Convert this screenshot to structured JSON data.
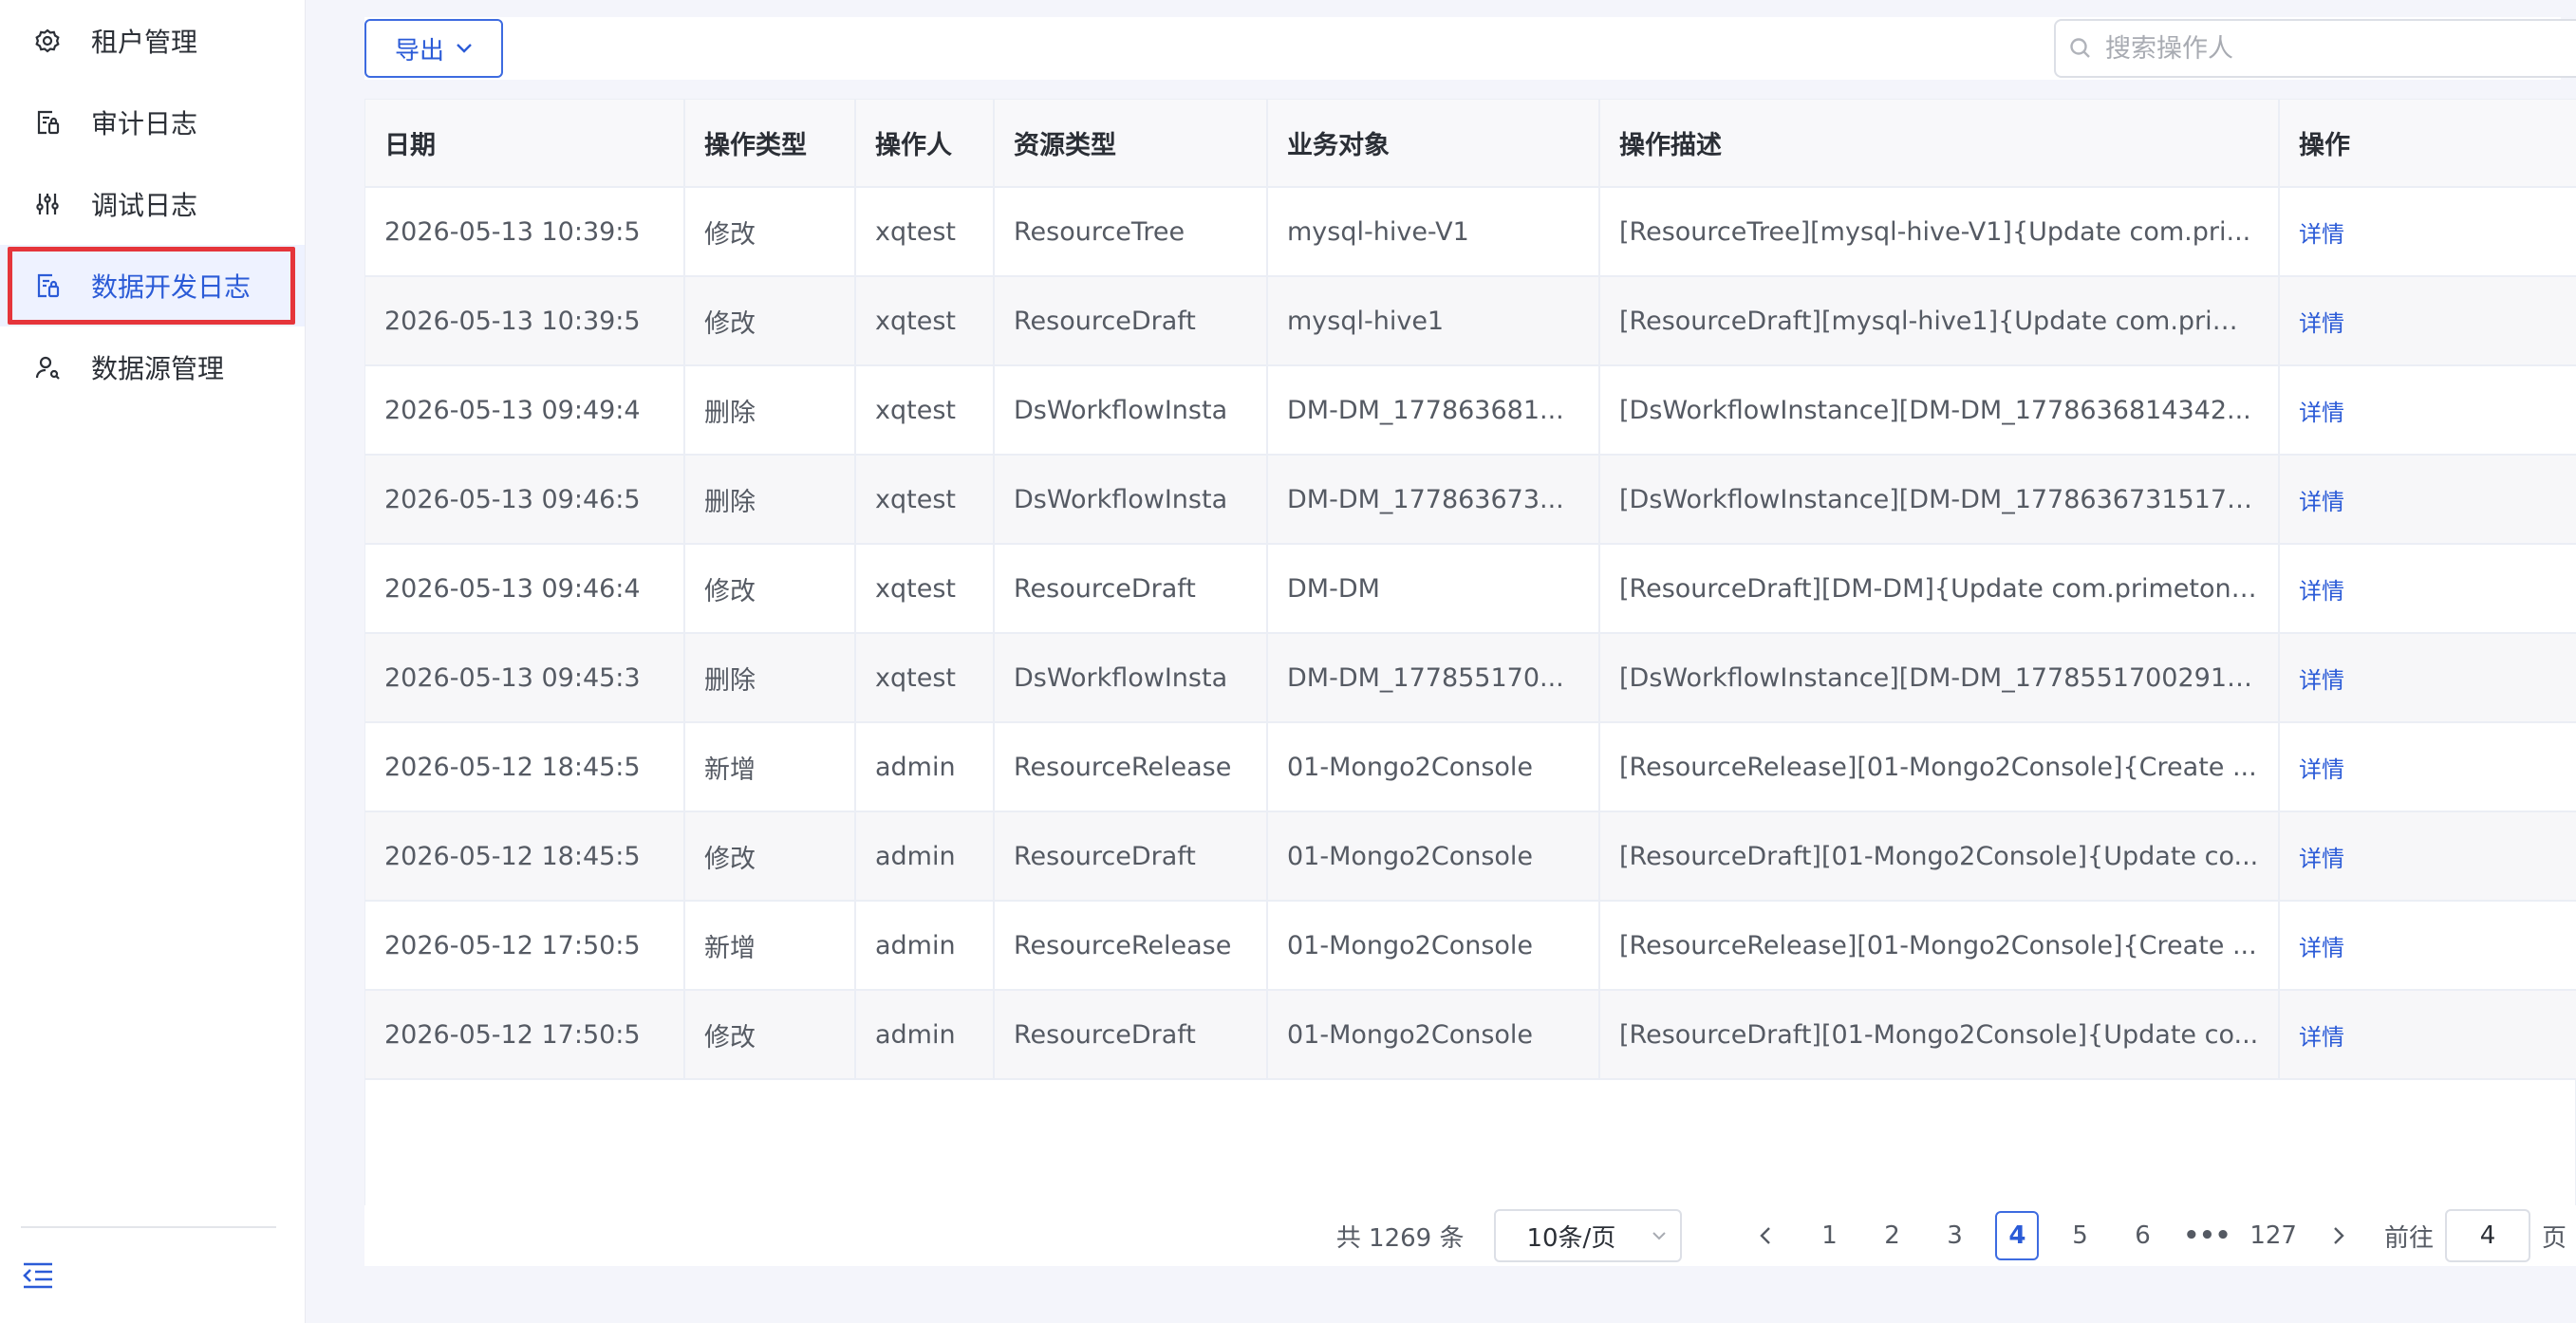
{
  "sidebar": {
    "items": [
      {
        "label": "租户管理",
        "icon": "gear-icon"
      },
      {
        "label": "审计日志",
        "icon": "audit-doc-icon"
      },
      {
        "label": "调试日志",
        "icon": "sliders-icon"
      },
      {
        "label": "数据开发日志",
        "icon": "dev-doc-icon",
        "active": true
      },
      {
        "label": "数据源管理",
        "icon": "user-datasource-icon"
      }
    ],
    "collapse_icon": "collapse-menu-icon"
  },
  "toolbar": {
    "export_label": "导出",
    "search_placeholder": "搜索操作人",
    "search_value": ""
  },
  "table": {
    "columns": [
      "日期",
      "操作类型",
      "操作人",
      "资源类型",
      "业务对象",
      "操作描述",
      "操作"
    ],
    "rows": [
      [
        "2026-05-13 10:39:5",
        "修改",
        "xqtest",
        "ResourceTree",
        "mysql-hive-V1",
        "[ResourceTree][mysql-hive-V1]{Update com.pri...",
        "详情"
      ],
      [
        "2026-05-13 10:39:5",
        "修改",
        "xqtest",
        "ResourceDraft",
        "mysql-hive1",
        "[ResourceDraft][mysql-hive1]{Update com.prim...",
        "详情"
      ],
      [
        "2026-05-13 09:49:4",
        "删除",
        "xqtest",
        "DsWorkflowInsta",
        "DM-DM_177863681...",
        "[DsWorkflowInstance][DM-DM_1778636814342...",
        "详情"
      ],
      [
        "2026-05-13 09:46:5",
        "删除",
        "xqtest",
        "DsWorkflowInsta",
        "DM-DM_177863673...",
        "[DsWorkflowInstance][DM-DM_1778636731517-...",
        "详情"
      ],
      [
        "2026-05-13 09:46:4",
        "修改",
        "xqtest",
        "ResourceDraft",
        "DM-DM",
        "[ResourceDraft][DM-DM]{Update com.primeton....",
        "详情"
      ],
      [
        "2026-05-13 09:45:3",
        "删除",
        "xqtest",
        "DsWorkflowInsta",
        "DM-DM_177855170...",
        "[DsWorkflowInstance][DM-DM_1778551700291-...",
        "详情"
      ],
      [
        "2026-05-12 18:45:5",
        "新增",
        "admin",
        "ResourceRelease",
        "01-Mongo2Console",
        "[ResourceRelease][01-Mongo2Console]{Create ...",
        "详情"
      ],
      [
        "2026-05-12 18:45:5",
        "修改",
        "admin",
        "ResourceDraft",
        "01-Mongo2Console",
        "[ResourceDraft][01-Mongo2Console]{Update co...",
        "详情"
      ],
      [
        "2026-05-12 17:50:5",
        "新增",
        "admin",
        "ResourceRelease",
        "01-Mongo2Console",
        "[ResourceRelease][01-Mongo2Console]{Create ...",
        "详情"
      ],
      [
        "2026-05-12 17:50:5",
        "修改",
        "admin",
        "ResourceDraft",
        "01-Mongo2Console",
        "[ResourceDraft][01-Mongo2Console]{Update co...",
        "详情"
      ]
    ]
  },
  "pagination": {
    "total_text": "共 1269 条",
    "page_size": "10条/页",
    "pages": [
      "1",
      "2",
      "3",
      "4",
      "5",
      "6",
      "•••",
      "127"
    ],
    "current": "4",
    "goto_label": "前往",
    "goto_value": "4",
    "page_unit": "页"
  },
  "colors": {
    "accent": "#2b5bd7",
    "highlight_border": "#e5353b",
    "active_bg": "#eef2ff"
  }
}
